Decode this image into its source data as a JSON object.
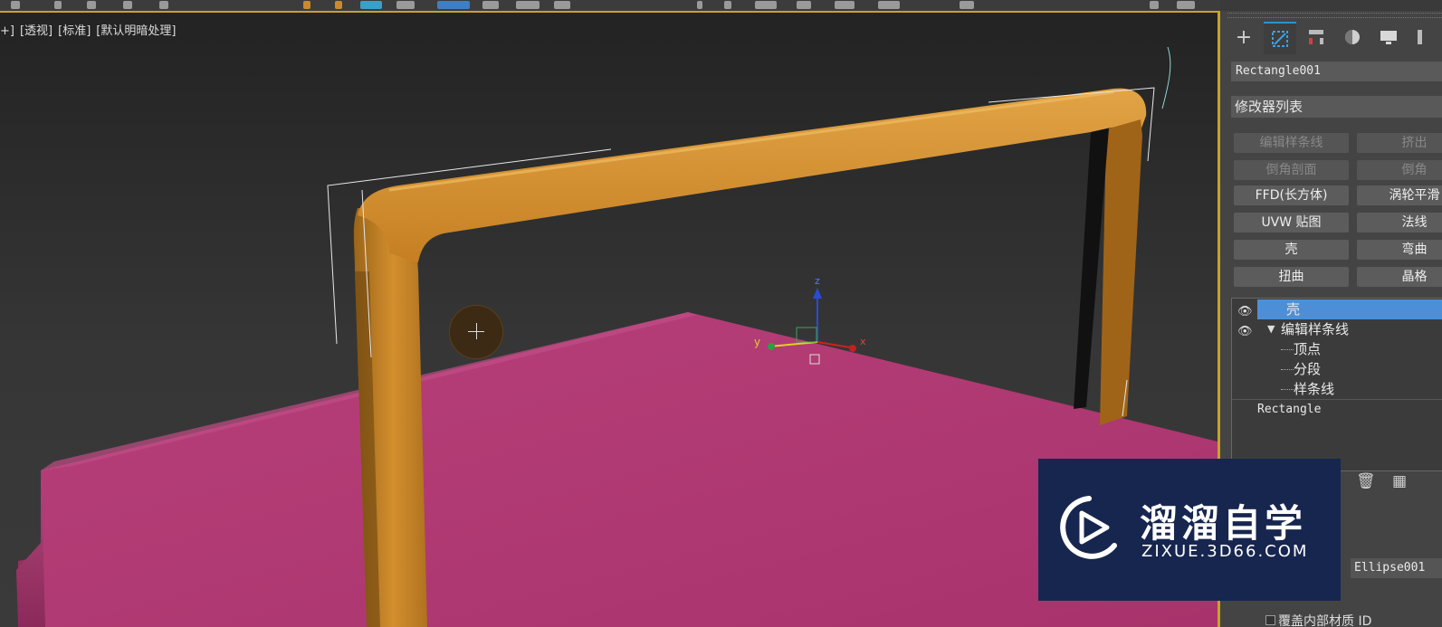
{
  "viewport": {
    "labels": [
      "+]",
      "[透视]",
      "[标准]",
      "[默认明暗处理]"
    ],
    "gizmo_axes": {
      "x": "x",
      "y": "y",
      "z": "z"
    }
  },
  "command_panel": {
    "tabs": [
      {
        "icon": "create-plus-icon"
      },
      {
        "icon": "modify-icon"
      },
      {
        "icon": "hierarchy-icon"
      },
      {
        "icon": "motion-icon"
      },
      {
        "icon": "display-icon"
      },
      {
        "icon": "utilities-icon"
      }
    ],
    "object_name": "Rectangle001",
    "modifier_list_label": "修改器列表",
    "modifier_buttons": [
      {
        "label": "编辑样条线",
        "enabled": false
      },
      {
        "label": "挤出",
        "enabled": false
      },
      {
        "label": "倒角剖面",
        "enabled": false
      },
      {
        "label": "倒角",
        "enabled": false
      },
      {
        "label": "FFD(长方体)",
        "enabled": true
      },
      {
        "label": "涡轮平滑",
        "enabled": true
      },
      {
        "label": "UVW 贴图",
        "enabled": true
      },
      {
        "label": "法线",
        "enabled": true
      },
      {
        "label": "壳",
        "enabled": true
      },
      {
        "label": "弯曲",
        "enabled": true
      },
      {
        "label": "扭曲",
        "enabled": true
      },
      {
        "label": "晶格",
        "enabled": true
      }
    ],
    "stack": {
      "items": [
        {
          "label": "壳",
          "selected": true
        },
        {
          "label": "编辑样条线",
          "expanded": true,
          "sub": [
            "顶点",
            "分段",
            "样条线"
          ]
        },
        {
          "label": "Rectangle"
        }
      ]
    },
    "ellipse_field": "Ellipse001",
    "bottom_option": "覆盖内部材质 ID"
  },
  "watermark": {
    "brand": "溜溜自学",
    "url": "ZIXUE.3D66.COM"
  },
  "colors": {
    "accent_frame": "#c9a227",
    "handle_orange": "#d18f2e",
    "box_magenta": "#b33a74",
    "selected_blue": "#4d8fd6"
  }
}
